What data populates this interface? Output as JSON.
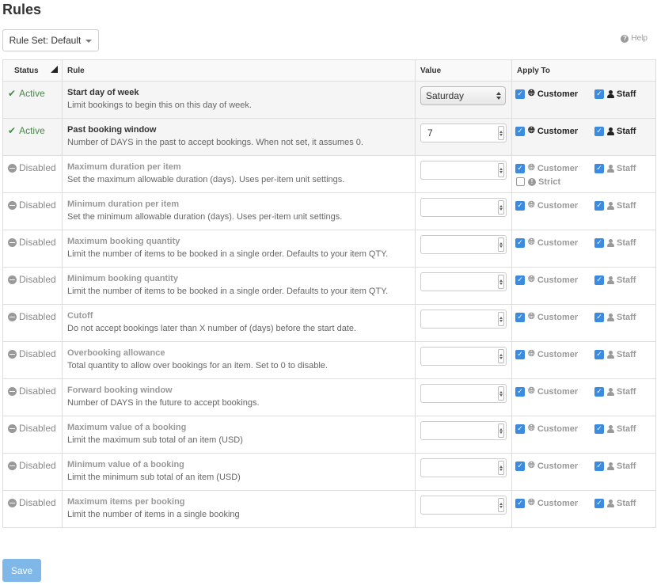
{
  "page": {
    "title": "Rules"
  },
  "toolbar": {
    "ruleset_label": "Rule Set: Default",
    "help_label": "Help"
  },
  "table": {
    "headers": {
      "status": "Status",
      "rule": "Rule",
      "value": "Value",
      "apply_to": "Apply To"
    },
    "labels": {
      "customer": "Customer",
      "staff": "Staff",
      "strict": "Strict"
    },
    "rows": [
      {
        "status": "Active",
        "name": "Start day of week",
        "desc": "Limit bookings to begin this on this day of week.",
        "value": "Saturday",
        "customer_checked": true,
        "staff_checked": true
      },
      {
        "status": "Active",
        "name": "Past booking window",
        "desc": "Number of DAYS in the past to accept bookings. When not set, it assumes 0.",
        "value": "7",
        "customer_checked": true,
        "staff_checked": true
      },
      {
        "status": "Disabled",
        "name": "Maximum duration per item",
        "desc": "Set the maximum allowable duration (days). Uses per-item unit settings.",
        "value": "",
        "customer_checked": true,
        "staff_checked": true,
        "strict_checked": false
      },
      {
        "status": "Disabled",
        "name": "Minimum duration per item",
        "desc": "Set the minimum allowable duration (days). Uses per-item unit settings.",
        "value": "",
        "customer_checked": true,
        "staff_checked": true
      },
      {
        "status": "Disabled",
        "name": "Maximum booking quantity",
        "desc": "Limit the number of items to be booked in a single order. Defaults to your item QTY.",
        "value": "",
        "customer_checked": true,
        "staff_checked": true
      },
      {
        "status": "Disabled",
        "name": "Minimum booking quantity",
        "desc": "Limit the number of items to be booked in a single order. Defaults to your item QTY.",
        "value": "",
        "customer_checked": true,
        "staff_checked": true
      },
      {
        "status": "Disabled",
        "name": "Cutoff",
        "desc": "Do not accept bookings later than X number of (days) before the start date.",
        "value": "",
        "customer_checked": true,
        "staff_checked": true
      },
      {
        "status": "Disabled",
        "name": "Overbooking allowance",
        "desc": "Total quantity to allow over bookings for an item. Set to 0 to disable.",
        "value": "",
        "customer_checked": true,
        "staff_checked": true
      },
      {
        "status": "Disabled",
        "name": "Forward booking window",
        "desc": "Number of DAYS in the future to accept bookings.",
        "value": "",
        "customer_checked": true,
        "staff_checked": true
      },
      {
        "status": "Disabled",
        "name": "Maximum value of a booking",
        "desc": "Limit the maximum sub total of an item (USD)",
        "value": "",
        "customer_checked": true,
        "staff_checked": true
      },
      {
        "status": "Disabled",
        "name": "Minimum value of a booking",
        "desc": "Limit the minimum sub total of an item (USD)",
        "value": "",
        "customer_checked": true,
        "staff_checked": true
      },
      {
        "status": "Disabled",
        "name": "Maximum items per booking",
        "desc": "Limit the number of items in a single booking",
        "value": "",
        "customer_checked": true,
        "staff_checked": true
      }
    ]
  },
  "footer": {
    "save_label": "Save"
  },
  "colors": {
    "active": "#468847",
    "accent": "#3b8ce0",
    "save_bg": "#7fb7e8",
    "disabled": "#999999"
  }
}
